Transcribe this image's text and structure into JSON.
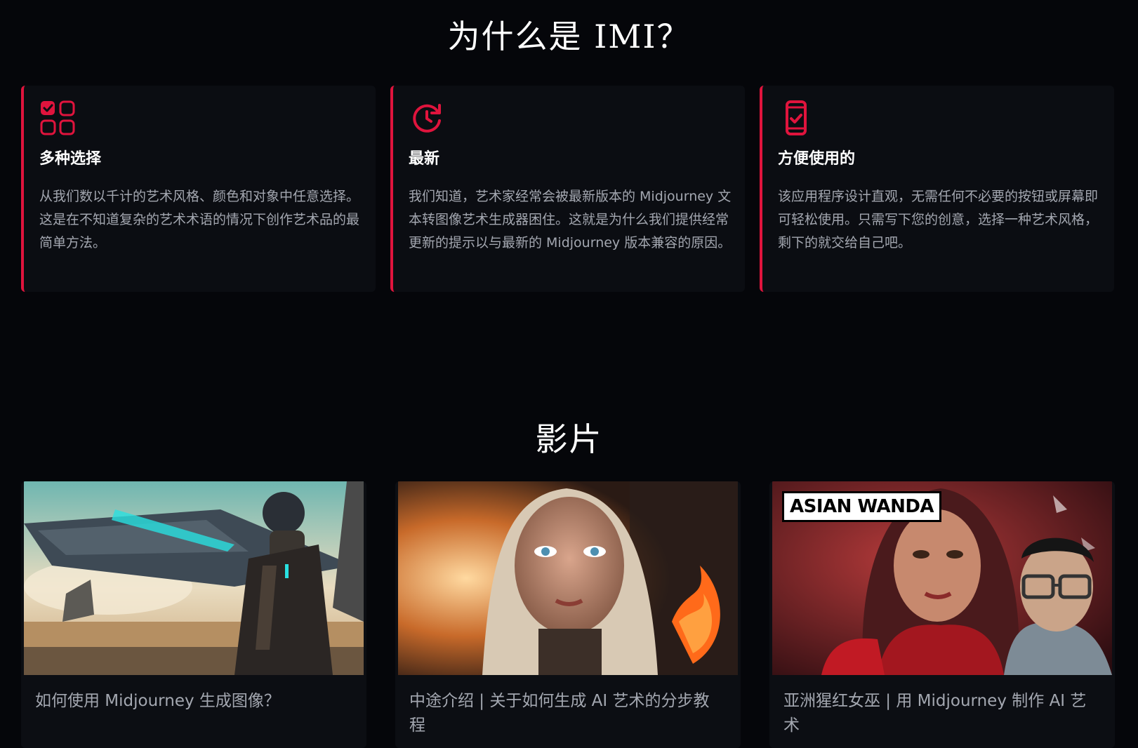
{
  "why_section": {
    "title": "为什么是 IMI？",
    "features": [
      {
        "icon": "grid-check-icon",
        "heading": "多种选择",
        "text": "从我们数以千计的艺术风格、颜色和对象中任意选择。这是在不知道复杂的艺术术语的情况下创作艺术品的最简单方法。"
      },
      {
        "icon": "clock-refresh-icon",
        "heading": "最新",
        "text": "我们知道，艺术家经常会被最新版本的 Midjourney 文本转图像艺术生成器困住。这就是为什么我们提供经常更新的提示以与最新的 Midjourney 版本兼容的原因。"
      },
      {
        "icon": "mobile-check-icon",
        "heading": "方便使用的",
        "text": "该应用程序设计直观，无需任何不必要的按钮或屏幕即可轻松使用。只需写下您的创意，选择一种艺术风格，剩下的就交给自己吧。"
      }
    ]
  },
  "videos_section": {
    "title": "影片",
    "videos": [
      {
        "title": "如何使用 Midjourney 生成图像？",
        "thumb": "sci-fi-armored-figure-spaceship"
      },
      {
        "title": "中途介绍 | 关于如何生成 AI 艺术的分步教程",
        "thumb": "woman-portrait-fire"
      },
      {
        "title": "亚洲猩红女巫 | 用 Midjourney 制作 AI 艺术",
        "thumb": "scarlet-witch-with-presenter",
        "badge": "ASIAN WANDA"
      }
    ]
  },
  "colors": {
    "background": "#05060a",
    "card": "#0b0d12",
    "accent": "#e0143d",
    "muted_text": "#a3a7b0"
  }
}
